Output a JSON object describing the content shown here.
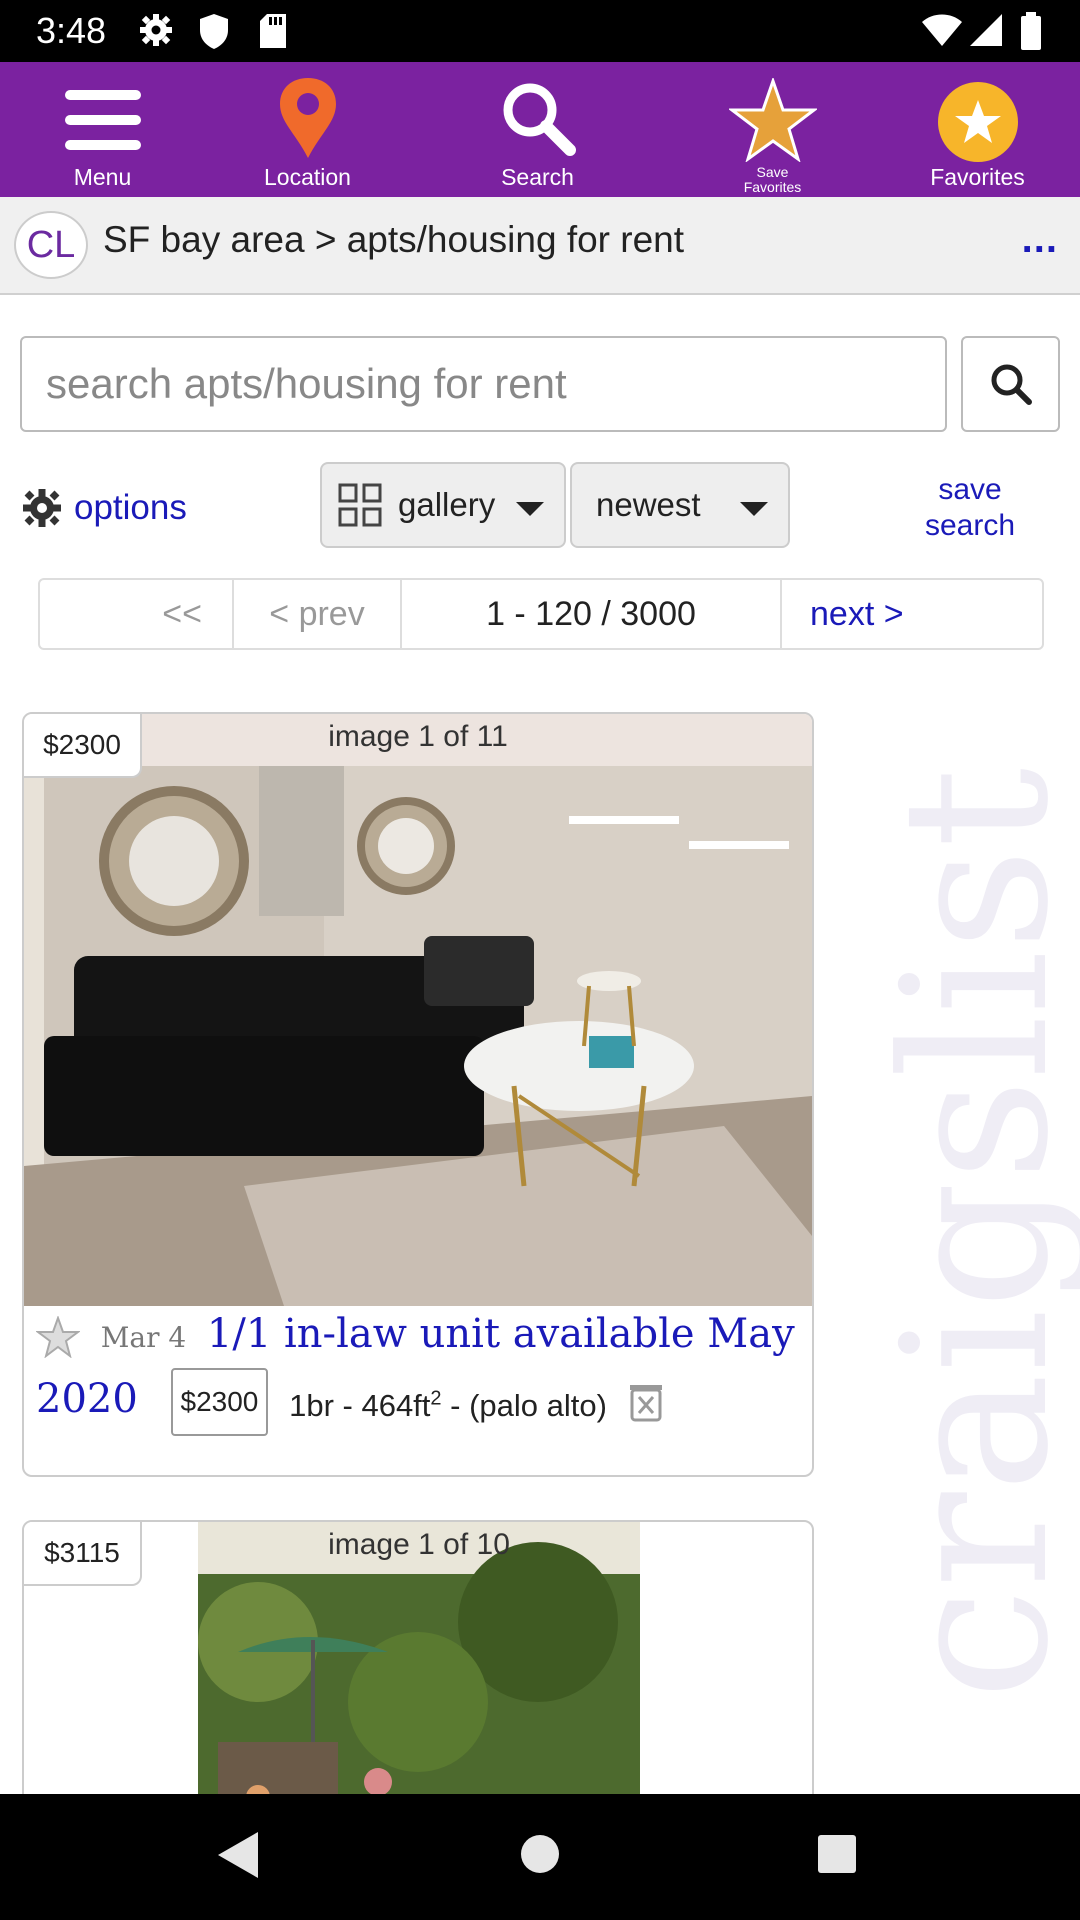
{
  "status_bar": {
    "time": "3:48"
  },
  "toolbar": {
    "menu_label": "Menu",
    "location_label": "Location",
    "search_label": "Search",
    "save_favorites_line1": "Save",
    "save_favorites_line2": "Favorites",
    "favorites_label": "Favorites",
    "colors": {
      "background": "#7b22a0",
      "location_pin": "#f06a2b",
      "star": "#e6a13a",
      "favorites_circle": "#f7b52a"
    }
  },
  "breadcrumb": {
    "logo": "CL",
    "path": "SF bay area > apts/housing for rent",
    "more": "..."
  },
  "watermark": "craigslist",
  "search": {
    "placeholder": "search apts/housing for rent",
    "button_icon": "search-icon"
  },
  "controls": {
    "options_label": "options",
    "view_mode": "gallery",
    "sort": "newest",
    "save_search_line1": "save",
    "save_search_line2": "search"
  },
  "pager": {
    "first": "<<",
    "prev": "< prev",
    "range": "1 - 120 / 3000",
    "next": "next >"
  },
  "listings": [
    {
      "price_tag": "$2300",
      "image_caption": "image 1 of 11",
      "date": "Mar 4",
      "title": "1/1 in-law unit available May 2020",
      "price": "$2300",
      "details_prefix": "1br - 464ft",
      "details_sup": "2",
      "details_suffix": " - (palo alto)"
    },
    {
      "price_tag": "$3115",
      "image_caption": "image 1 of 10"
    }
  ]
}
